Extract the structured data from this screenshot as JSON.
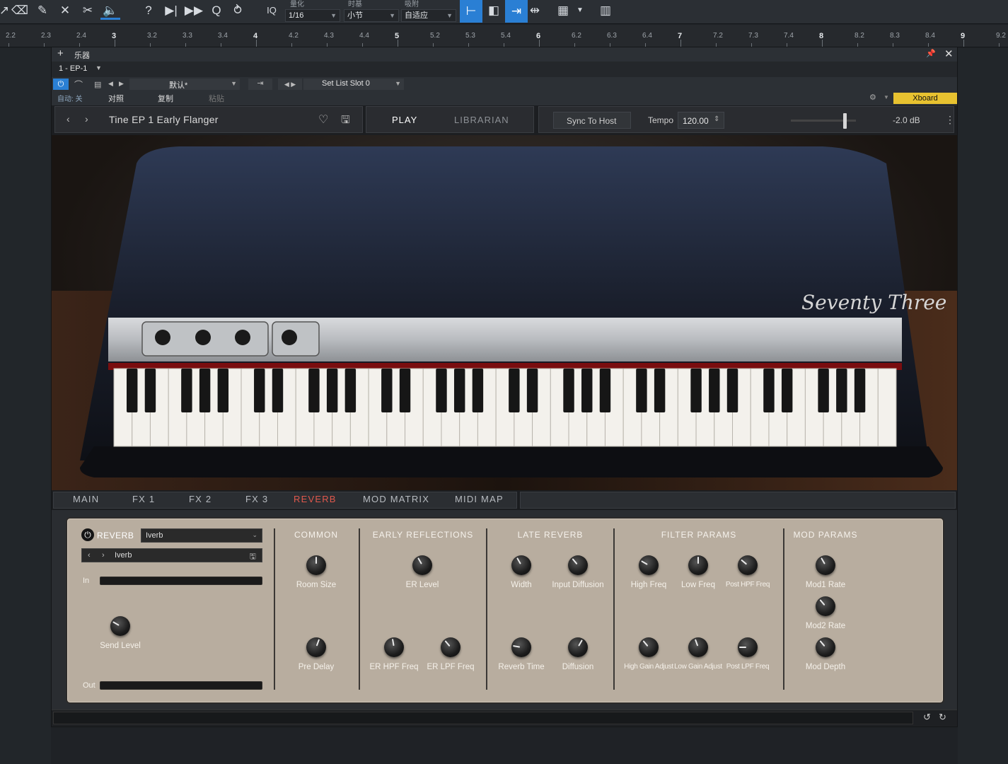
{
  "toolbar": {
    "quantize_label": "量化",
    "quantize_value": "1/16",
    "timebase_label": "时基",
    "timebase_value": "小节",
    "snap_label": "吸附",
    "snap_value": "自适应",
    "iq_label": "IQ"
  },
  "ruler": {
    "marks": [
      "2.2",
      "2.3",
      "2.4",
      "3",
      "3.2",
      "3.3",
      "3.4",
      "4",
      "4.2",
      "4.3",
      "4.4",
      "5",
      "5.2",
      "5.3",
      "5.4",
      "6",
      "6.2",
      "6.3",
      "6.4",
      "7",
      "7.2",
      "7.3",
      "7.4",
      "8",
      "8.2",
      "8.3",
      "8.4",
      "9",
      "9.2"
    ]
  },
  "window": {
    "title": "乐器",
    "track_name": "1 - EP-1",
    "auto_label": "自动: 关",
    "compare_label": "对照",
    "copy_label": "复制",
    "paste_label": "粘贴",
    "preset_name": "默认*",
    "setlist_slot": "Set List Slot 0",
    "xboard_label": "Xboard"
  },
  "plugin": {
    "preset_title": "Tine EP 1 Early Flanger",
    "play_tab": "PLAY",
    "librarian_tab": "LIBRARIAN",
    "sync_label": "Sync To Host",
    "tempo_label": "Tempo",
    "tempo_value": "120.00",
    "volume_db": "-2.0 dB",
    "volume_slider": 0.83,
    "logo_text": "Seventy Three"
  },
  "tabs": [
    {
      "label": "MAIN"
    },
    {
      "label": "FX 1"
    },
    {
      "label": "FX 2"
    },
    {
      "label": "FX 3"
    },
    {
      "label": "REVERB"
    },
    {
      "label": "MOD MATRIX"
    },
    {
      "label": "MIDI MAP"
    }
  ],
  "reverb": {
    "title": "REVERB",
    "type_value": "Iverb",
    "preset_value": "Iverb",
    "in_label": "In",
    "out_label": "Out",
    "send_level_label": "Send Level",
    "sections": {
      "common": "COMMON",
      "early": "EARLY REFLECTIONS",
      "late": "LATE REVERB",
      "filter": "FILTER PARAMS",
      "mod": "MOD PARAMS"
    },
    "knobs": {
      "room_size": "Room Size",
      "pre_delay": "Pre Delay",
      "er_level": "ER Level",
      "er_hpf_freq": "ER HPF Freq",
      "er_lpf_freq": "ER LPF Freq",
      "width": "Width",
      "input_diffusion": "Input Diffusion",
      "reverb_time": "Reverb Time",
      "diffusion": "Diffusion",
      "high_freq": "High Freq",
      "low_freq": "Low Freq",
      "post_hpf_freq": "Post HPF Freq",
      "high_gain_adjust": "High Gain Adjust",
      "low_gain_adjust": "Low Gain Adjust",
      "post_lpf_freq": "Post LPF Freq",
      "mod1_rate": "Mod1 Rate",
      "mod2_rate": "Mod2 Rate",
      "mod_depth": "Mod Depth"
    }
  }
}
